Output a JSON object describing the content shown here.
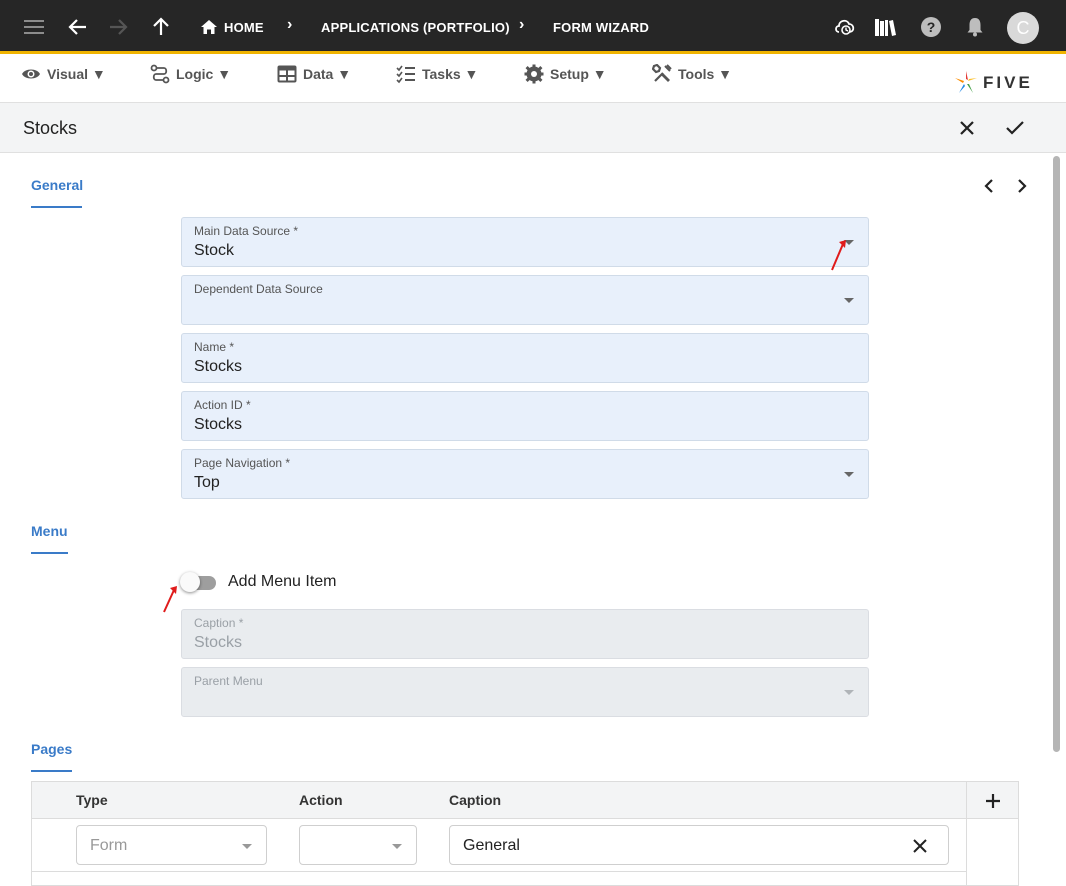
{
  "appbar": {
    "breadcrumbs": [
      "HOME",
      "APPLICATIONS (PORTFOLIO)",
      "FORM WIZARD"
    ],
    "avatar_letter": "C",
    "icons": [
      "menu-icon",
      "back-arrow-icon",
      "forward-arrow-icon",
      "up-arrow-icon",
      "home-icon",
      "cloud-sync-icon",
      "library-icon",
      "help-icon",
      "bell-icon"
    ]
  },
  "toolbar": {
    "items": [
      {
        "label": "Visual ▼",
        "icon": "eye-icon"
      },
      {
        "label": "Logic ▼",
        "icon": "flow-icon"
      },
      {
        "label": "Data ▼",
        "icon": "table-icon"
      },
      {
        "label": "Tasks ▼",
        "icon": "checklist-icon"
      },
      {
        "label": "Setup ▼",
        "icon": "gear-icon"
      },
      {
        "label": "Tools ▼",
        "icon": "wrench-icon"
      }
    ],
    "logo_text": "FIVE"
  },
  "form": {
    "title": "Stocks"
  },
  "general": {
    "section_label": "General",
    "fields": [
      {
        "label": "Main Data Source *",
        "value": "Stock"
      },
      {
        "label": "Dependent Data Source",
        "value": ""
      },
      {
        "label": "Name *",
        "value": "Stocks"
      },
      {
        "label": "Action ID *",
        "value": "Stocks"
      },
      {
        "label": "Page Navigation *",
        "value": "Top"
      }
    ]
  },
  "menu": {
    "section_label": "Menu",
    "toggle_label": "Add Menu Item",
    "toggle_on": false,
    "caption": {
      "label": "Caption *",
      "value": "Stocks"
    },
    "parent_menu": {
      "label": "Parent Menu",
      "value": ""
    }
  },
  "pages": {
    "section_label": "Pages",
    "columns": [
      "Type",
      "Action",
      "Caption"
    ],
    "rows": [
      {
        "type_placeholder": "Form",
        "action": "",
        "caption": "General"
      }
    ]
  },
  "colors": {
    "appbar_bg": "#262626",
    "accent_underline": "#f0b400",
    "section_blue": "#3a7bc8",
    "field_bg": "#e8f0fb"
  }
}
